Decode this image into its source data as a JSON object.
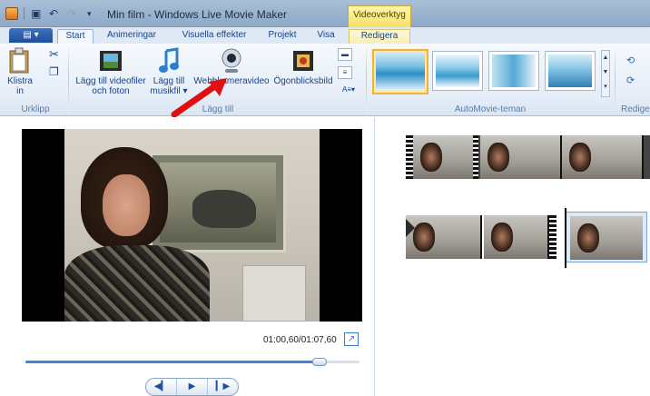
{
  "titlebar": {
    "title": "Min film - Windows Live Movie Maker",
    "context_header": "Videoverktyg",
    "quick_access": [
      "save-icon",
      "undo-icon",
      "redo-icon",
      "customize-icon"
    ]
  },
  "tabs": {
    "file_label": "",
    "items": [
      {
        "label": "Start",
        "active": true
      },
      {
        "label": "Animeringar"
      },
      {
        "label": "Visuella effekter"
      },
      {
        "label": "Projekt"
      },
      {
        "label": "Visa"
      },
      {
        "label": "Redigera",
        "contextual": true
      }
    ]
  },
  "ribbon": {
    "clipboard": {
      "paste_label": "Klistra in",
      "group_label": "Urklipp",
      "icons": [
        "paste-icon",
        "cut-icon",
        "copy-icon"
      ]
    },
    "add": {
      "add_video_label": "Lägg till videofiler och foton",
      "add_music_label": "Lägg till musikfil ▾",
      "webcam_label": "Webbkameravideo",
      "snapshot_label": "Ögonblicksbild",
      "group_label": "Lägg till"
    },
    "automovie": {
      "group_label": "AutoMovie-teman",
      "themes_count_visible": 4,
      "selected_index": 0
    },
    "edit": {
      "group_label": "Redige"
    }
  },
  "preview": {
    "timecode": "01:00,60/01:07,60",
    "seek_fraction": 0.88,
    "controls": [
      "previous-frame-icon",
      "play-icon",
      "next-frame-icon"
    ]
  },
  "storyboard": {
    "rows": 2,
    "selected_clip_row": 2
  },
  "colors": {
    "accent": "#3f84d6",
    "context_tab": "#f4e168",
    "annotation_arrow": "#e01010"
  }
}
